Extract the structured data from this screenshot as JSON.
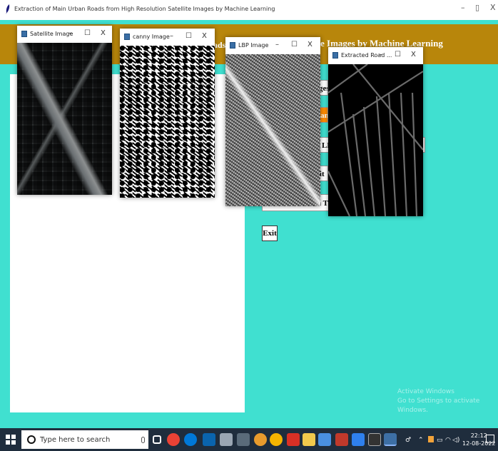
{
  "main_window": {
    "title": "Extraction of Main Urban Roads from High Resolution Satellite Images by Machine Learning",
    "minimize_glyph": "–",
    "restore_glyph": "▯",
    "close_glyph": "X"
  },
  "heading": {
    "fragment_left": "ads",
    "fragment_right": "e Images by Machine Learning"
  },
  "buttons": {
    "b1": "ges",
    "b2": "an",
    "b3": "LF",
    "b4": "rit",
    "b5": "n T",
    "exit": "Exit"
  },
  "windows": {
    "satellite": {
      "title": "Satellite Image",
      "min": "–",
      "max": "☐",
      "close": "X"
    },
    "canny": {
      "title": "canny Image",
      "min": "–",
      "max": "☐",
      "close": "X"
    },
    "lbp": {
      "title": "LBP Image",
      "min": "–",
      "max": "☐",
      "close": "X"
    },
    "road": {
      "title": "Extracted Road ...",
      "min": "–",
      "max": "☐",
      "close": "X"
    }
  },
  "watermark": {
    "line1": "Activate Windows",
    "line2": "Go to Settings to activate Windows."
  },
  "taskbar": {
    "search_placeholder": "Type here to search",
    "time": "22:12",
    "date": "12-08-2022",
    "apps": [
      "task-view",
      "chrome",
      "edge",
      "mail",
      "files",
      "store",
      "paint",
      "chrome-alt",
      "acrobat",
      "explorer",
      "notepad",
      "photos",
      "vscode",
      "terminal",
      "python"
    ],
    "colors": {
      "bg": "#1f2d3d",
      "accent": "#0078d7"
    }
  },
  "theme": {
    "background": "#40e0d0",
    "band": "#b8860b",
    "button_orange": "#ff8c00"
  }
}
